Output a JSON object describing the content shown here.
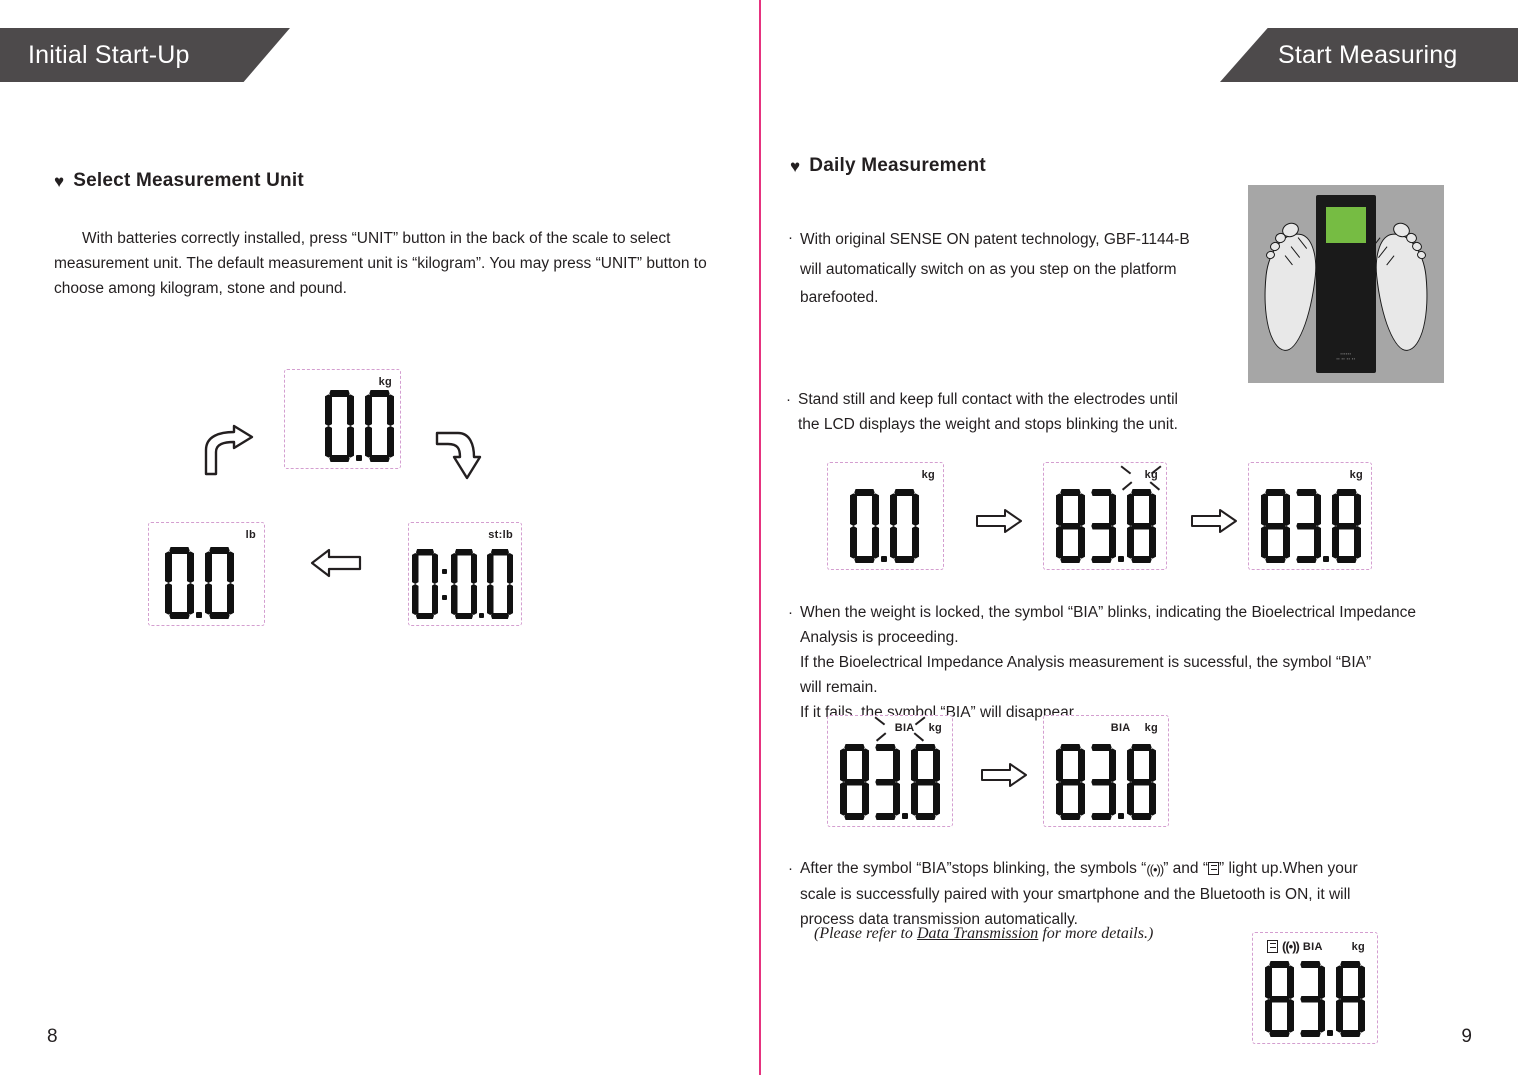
{
  "document": {
    "left_page": {
      "banner_title": "Initial Start-Up",
      "page_number": "8",
      "section": {
        "bullet_icon": "heart-icon",
        "heading": "Select Measurement Unit",
        "paragraph": "With batteries correctly installed, press “UNIT” button in the back of the scale to select measurement unit. The default measurement unit is “kilogram”. You may press “UNIT” button to choose among kilogram, stone and pound."
      },
      "unit_cycle": {
        "displays": [
          {
            "id": "kg",
            "unit_label": "kg",
            "value": "0.0",
            "position": "top"
          },
          {
            "id": "stlb",
            "unit_label": "st:lb",
            "value": "0:0.0",
            "position": "bottom-right"
          },
          {
            "id": "lb",
            "unit_label": "lb",
            "value": "0.0",
            "position": "bottom-left"
          }
        ],
        "arrows": [
          {
            "name": "curve-arrow-up-right",
            "direction": "up-right"
          },
          {
            "name": "curve-arrow-down-right",
            "direction": "down-right"
          },
          {
            "name": "block-arrow-left",
            "direction": "left"
          }
        ]
      }
    },
    "right_page": {
      "banner_title": "Start Measuring",
      "page_number": "9",
      "section": {
        "bullet_icon": "heart-icon",
        "heading": "Daily Measurement"
      },
      "bullets": [
        {
          "id": "sense-on",
          "lines": [
            "With original SENSE ON patent technology, GBF-1144-B",
            "will automatically switch on as you step on the platform",
            "barefooted."
          ]
        },
        {
          "id": "stand-still",
          "lines": [
            "Stand still and keep full contact with the electrodes until",
            "the LCD displays the weight and stops blinking the unit."
          ]
        },
        {
          "id": "bia-blink",
          "lines": [
            "When the weight is locked, the symbol “BIA” blinks, indicating the Bioelectrical Impedance",
            "Analysis is proceeding.",
            "If the Bioelectrical Impedance Analysis measurement is sucessful, the symbol “BIA”",
            "will remain.",
            "If it fails, the symbol “BIA” will disappear."
          ]
        },
        {
          "id": "bluetooth-transmit",
          "line1_a": "After the symbol “BIA”stops blinking, the symbols “",
          "symbol_wave": "wireless-wave-icon",
          "line1_b": "” and “",
          "symbol_doc": "data-record-icon",
          "line1_c": "” light up.When your",
          "line2": "scale is successfully paired with your smartphone and the Bluetooth is ON, it will",
          "line3": "process data transmission automatically.",
          "note_prefix": "(Please refer to ",
          "note_link": "Data Transmission",
          "note_suffix": " for more details.)"
        }
      ],
      "photo": {
        "name": "scale-with-feet-photo",
        "screen_color": "#76bc43",
        "body_color": "#1a1a1a",
        "background_color": "#a6a6a6",
        "brand_line1": "▪▪▪▪▪▪",
        "brand_line2": "▪▪ ▪▪ ▪▪ ▪▪"
      },
      "weight_sequence": [
        {
          "id": "zero",
          "unit_label": "kg",
          "value": "0.0",
          "bia": false,
          "blinking": false
        },
        {
          "id": "locking",
          "unit_label": "kg",
          "value": "83.8",
          "bia": false,
          "blinking": true
        },
        {
          "id": "locked",
          "unit_label": "kg",
          "value": "83.8",
          "bia": false,
          "blinking": false
        }
      ],
      "bia_sequence": [
        {
          "id": "bia-blinking",
          "unit_label": "kg",
          "bia_label": "BIA",
          "value": "83.8",
          "blinking": true
        },
        {
          "id": "bia-steady",
          "unit_label": "kg",
          "bia_label": "BIA",
          "value": "83.8",
          "blinking": false
        }
      ],
      "transmit_display": {
        "id": "transmitting",
        "unit_label": "kg",
        "bia_label": "BIA",
        "value": "83.8",
        "icons": [
          "data-record-icon",
          "wireless-wave-icon"
        ]
      }
    },
    "colors": {
      "banner": "#4d4a4b",
      "divider": "#e6327f",
      "lcd_border": "#d49ed0",
      "text": "#231f20",
      "segment": "#111111"
    }
  }
}
